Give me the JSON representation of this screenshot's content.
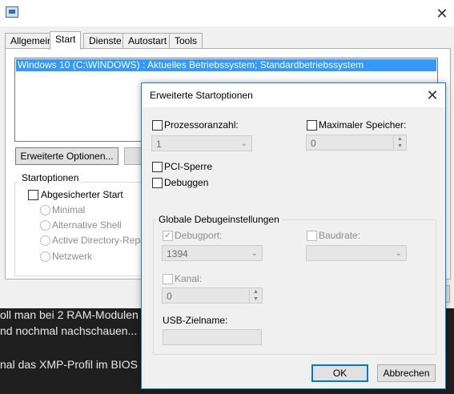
{
  "main_window": {
    "tabs": [
      {
        "label": "Allgemein"
      },
      {
        "label": "Start"
      },
      {
        "label": "Dienste"
      },
      {
        "label": "Autostart"
      },
      {
        "label": "Tools"
      }
    ],
    "active_tab": "Start",
    "os_entries": [
      "Windows 10 (C:\\WINDOWS) : Aktuelles Betriebssystem; Standardbetriebssystem"
    ],
    "advanced_button_label": "Erweiterte Optionen...",
    "boot_options_label": "Startoptionen",
    "safe_boot_label": "Abgesicherter Start",
    "safe_boot_modes": [
      {
        "label": "Minimal"
      },
      {
        "label": "Alternative Shell"
      },
      {
        "label": "Active Directory-Repara"
      },
      {
        "label": "Netzwerk"
      }
    ]
  },
  "background_text": {
    "lines": [
      "oll man bei 2 RAM-Modulen",
      "nd nochmal nachschauen...",
      "",
      "nal das XMP-Profil im BIOS"
    ]
  },
  "dialog": {
    "title": "Erweiterte Startoptionen",
    "processor_count_label": "Prozessoranzahl:",
    "processor_count_value": "1",
    "max_memory_label": "Maximaler Speicher:",
    "max_memory_value": "0",
    "pci_lock_label": "PCI-Sperre",
    "debug_label": "Debuggen",
    "debug_group_label": "Globale Debugeinstellungen",
    "debug_port_label": "Debugport:",
    "debug_port_value": "1394",
    "baud_rate_label": "Baudrate:",
    "baud_rate_value": "",
    "channel_label": "Kanal:",
    "channel_value": "0",
    "usb_target_label": "USB-Zielname:",
    "usb_target_value": "",
    "ok_label": "OK",
    "cancel_label": "Abbrechen"
  },
  "colors": {
    "selection": "#3399ff",
    "dialog_border": "#1a7ccf",
    "ok_focus": "#0078d7",
    "overlay_background": "#1f1f1f"
  }
}
